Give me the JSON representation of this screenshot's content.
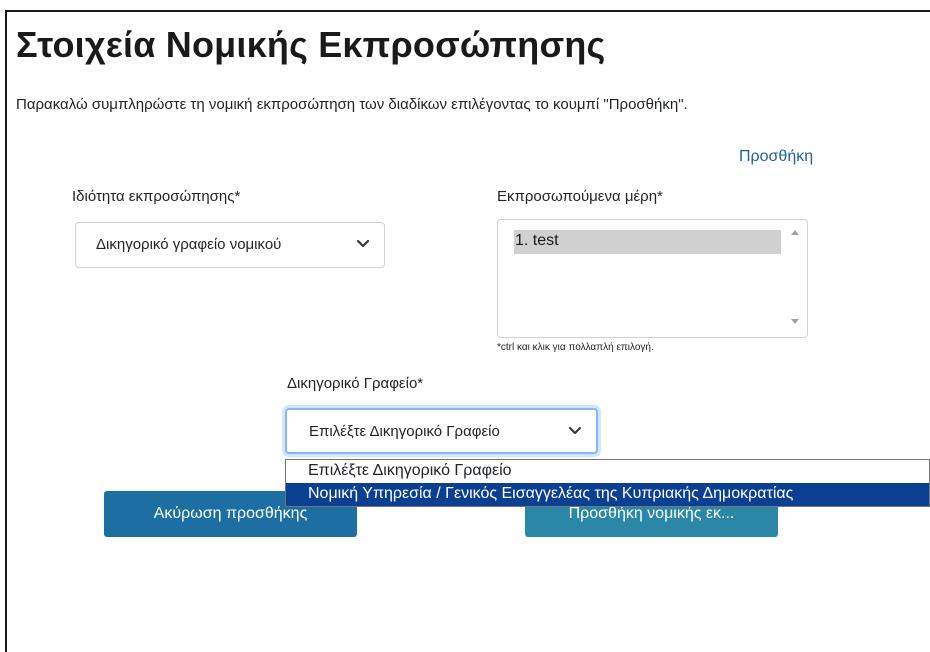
{
  "page": {
    "title": "Στοιχεία Νομικής Εκπροσώπησης",
    "instructions": "Παρακαλώ συμπληρώστε τη νομική εκπροσώπηση των διαδίκων επιλέγοντας το κουμπί \"Προσθήκη\".",
    "add_link": "Προσθήκη"
  },
  "form": {
    "capacity": {
      "label": "Ιδιότητα εκπροσώπησης*",
      "selected": "Δικηγορικό γραφείο νομικού"
    },
    "represented_parties": {
      "label": "Εκπροσωπούμενα μέρη*",
      "options": [
        "1. test"
      ],
      "hint": "*ctrl και κλικ για πολλαπλή επιλογή."
    },
    "law_firm": {
      "label": "Δικηγορικό Γραφείο*",
      "selected": "Επιλέξτε Δικηγορικό Γραφείο",
      "dropdown_options": [
        "Επιλέξτε Δικηγορικό Γραφείο",
        "Νομική Υπηρεσία / Γενικός Εισαγγελέας της Κυπριακής Δημοκρατίας"
      ],
      "highlighted_index": 1
    }
  },
  "buttons": {
    "cancel": "Ακύρωση προσθήκης",
    "add": "Προσθήκη νομικής εκ..."
  },
  "colors": {
    "link": "#1f5f99",
    "cancel_button": "#1d6fa3",
    "add_button": "#2a87a7",
    "dropdown_highlight": "#0a3f91",
    "listbox_selection": "#d0d0d0"
  }
}
